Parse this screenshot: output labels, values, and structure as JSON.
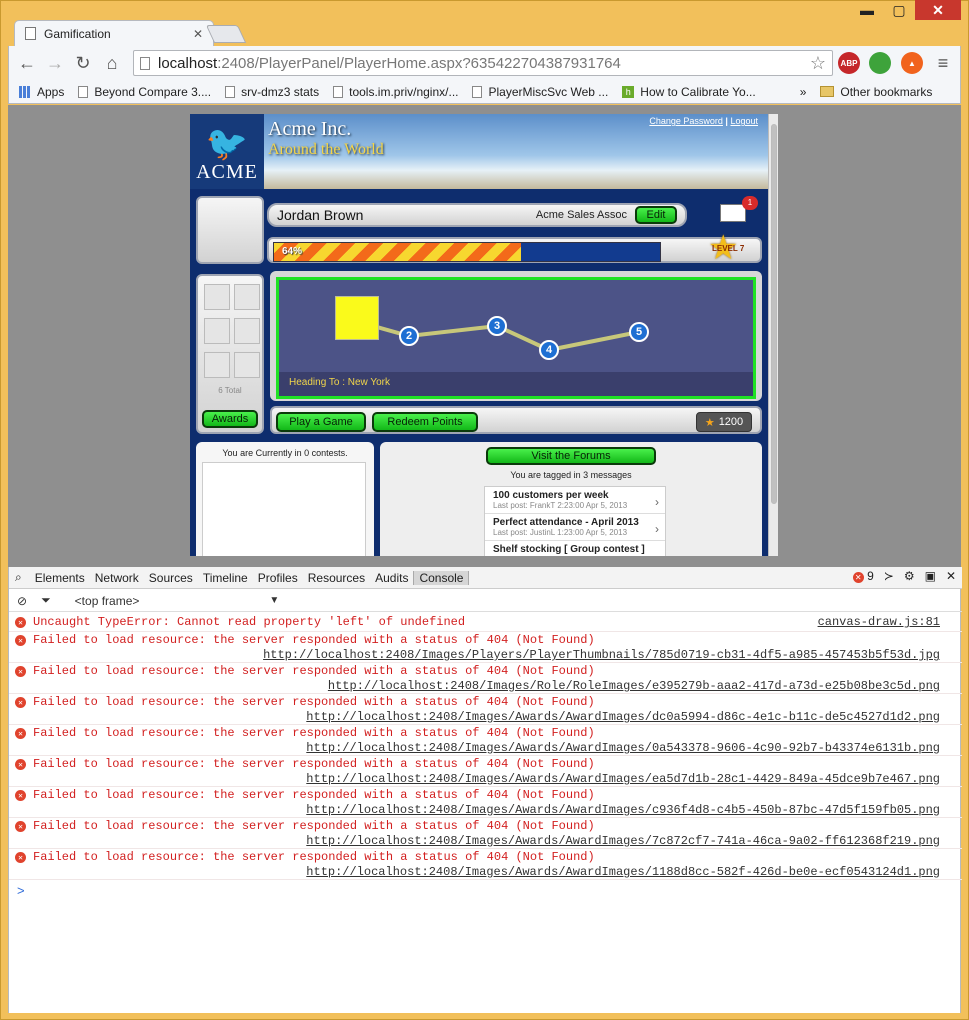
{
  "browser": {
    "tab_title": "Gamification",
    "url_host": "localhost",
    "url_path": ":2408/PlayerPanel/PlayerHome.aspx?635422704387931764",
    "extensions": [
      "ABP",
      "evernote",
      "fire"
    ],
    "bookmarks": [
      "Apps",
      "Beyond Compare 3....",
      "srv-dmz3 stats",
      "tools.im.priv/nginx/...",
      "PlayerMiscSvc Web ...",
      "How to Calibrate Yo..."
    ],
    "bookmarks_more": "»",
    "other_bookmarks": "Other bookmarks"
  },
  "site": {
    "logo_text": "ACME",
    "company": "Acme Inc.",
    "tagline": "Around the World",
    "link_change_password": "Change Password",
    "link_separator": "|",
    "link_logout": "Logout",
    "player_name": "Jordan Brown",
    "role": "Acme Sales Assoc",
    "edit_label": "Edit",
    "mail_count": "1",
    "progress_text": "64%",
    "progress_value": 0.64,
    "level_text": "LEVEL 7",
    "award_total": "6 Total",
    "awards_button": "Awards",
    "map_nodes": [
      "2",
      "3",
      "4",
      "5"
    ],
    "heading_to": "Heading To : New York",
    "play_button": "Play a Game",
    "redeem_button": "Redeem Points",
    "points": "1200",
    "contests_text": "You are Currently in  0 contests.",
    "forums_button": "Visit the Forums",
    "tagged_text": "You are tagged in 3 messages",
    "forum_items": [
      {
        "title": "100 customers per week",
        "post": "Last post: FrankT 2:23:00 Apr 5, 2013"
      },
      {
        "title": "Perfect attendance - April 2013",
        "post": "Last post: JustinL 1:23:00 Apr 5, 2013"
      },
      {
        "title": "Shelf stocking [ Group contest ]",
        "post": ""
      }
    ]
  },
  "devtools": {
    "tabs": [
      "Elements",
      "Network",
      "Sources",
      "Timeline",
      "Profiles",
      "Resources",
      "Audits",
      "Console"
    ],
    "active_tab": "Console",
    "error_count": "9",
    "frame_selector": "<top frame>",
    "logs": [
      {
        "msg": "Uncaught TypeError: Cannot read property 'left' of undefined",
        "src": "canvas-draw.js:81"
      },
      {
        "msg": "Failed to load resource: the server responded with a status of 404 (Not Found)",
        "src": "http://localhost:2408/Images/Players/PlayerThumbnails/785d0719-cb31-4df5-a985-457453b5f53d.jpg"
      },
      {
        "msg": "Failed to load resource: the server responded with a status of 404 (Not Found)",
        "src": "http://localhost:2408/Images/Role/RoleImages/e395279b-aaa2-417d-a73d-e25b08be3c5d.png"
      },
      {
        "msg": "Failed to load resource: the server responded with a status of 404 (Not Found)",
        "src": "http://localhost:2408/Images/Awards/AwardImages/dc0a5994-d86c-4e1c-b11c-de5c4527d1d2.png"
      },
      {
        "msg": "Failed to load resource: the server responded with a status of 404 (Not Found)",
        "src": "http://localhost:2408/Images/Awards/AwardImages/0a543378-9606-4c90-92b7-b43374e6131b.png"
      },
      {
        "msg": "Failed to load resource: the server responded with a status of 404 (Not Found)",
        "src": "http://localhost:2408/Images/Awards/AwardImages/ea5d7d1b-28c1-4429-849a-45dce9b7e467.png"
      },
      {
        "msg": "Failed to load resource: the server responded with a status of 404 (Not Found)",
        "src": "http://localhost:2408/Images/Awards/AwardImages/c936f4d8-c4b5-450b-87bc-47d5f159fb05.png"
      },
      {
        "msg": "Failed to load resource: the server responded with a status of 404 (Not Found)",
        "src": "http://localhost:2408/Images/Awards/AwardImages/7c872cf7-741a-46ca-9a02-ff612368f219.png"
      },
      {
        "msg": "Failed to load resource: the server responded with a status of 404 (Not Found)",
        "src": "http://localhost:2408/Images/Awards/AwardImages/1188d8cc-582f-426d-be0e-ecf0543124d1.png"
      }
    ],
    "prompt": ">"
  }
}
